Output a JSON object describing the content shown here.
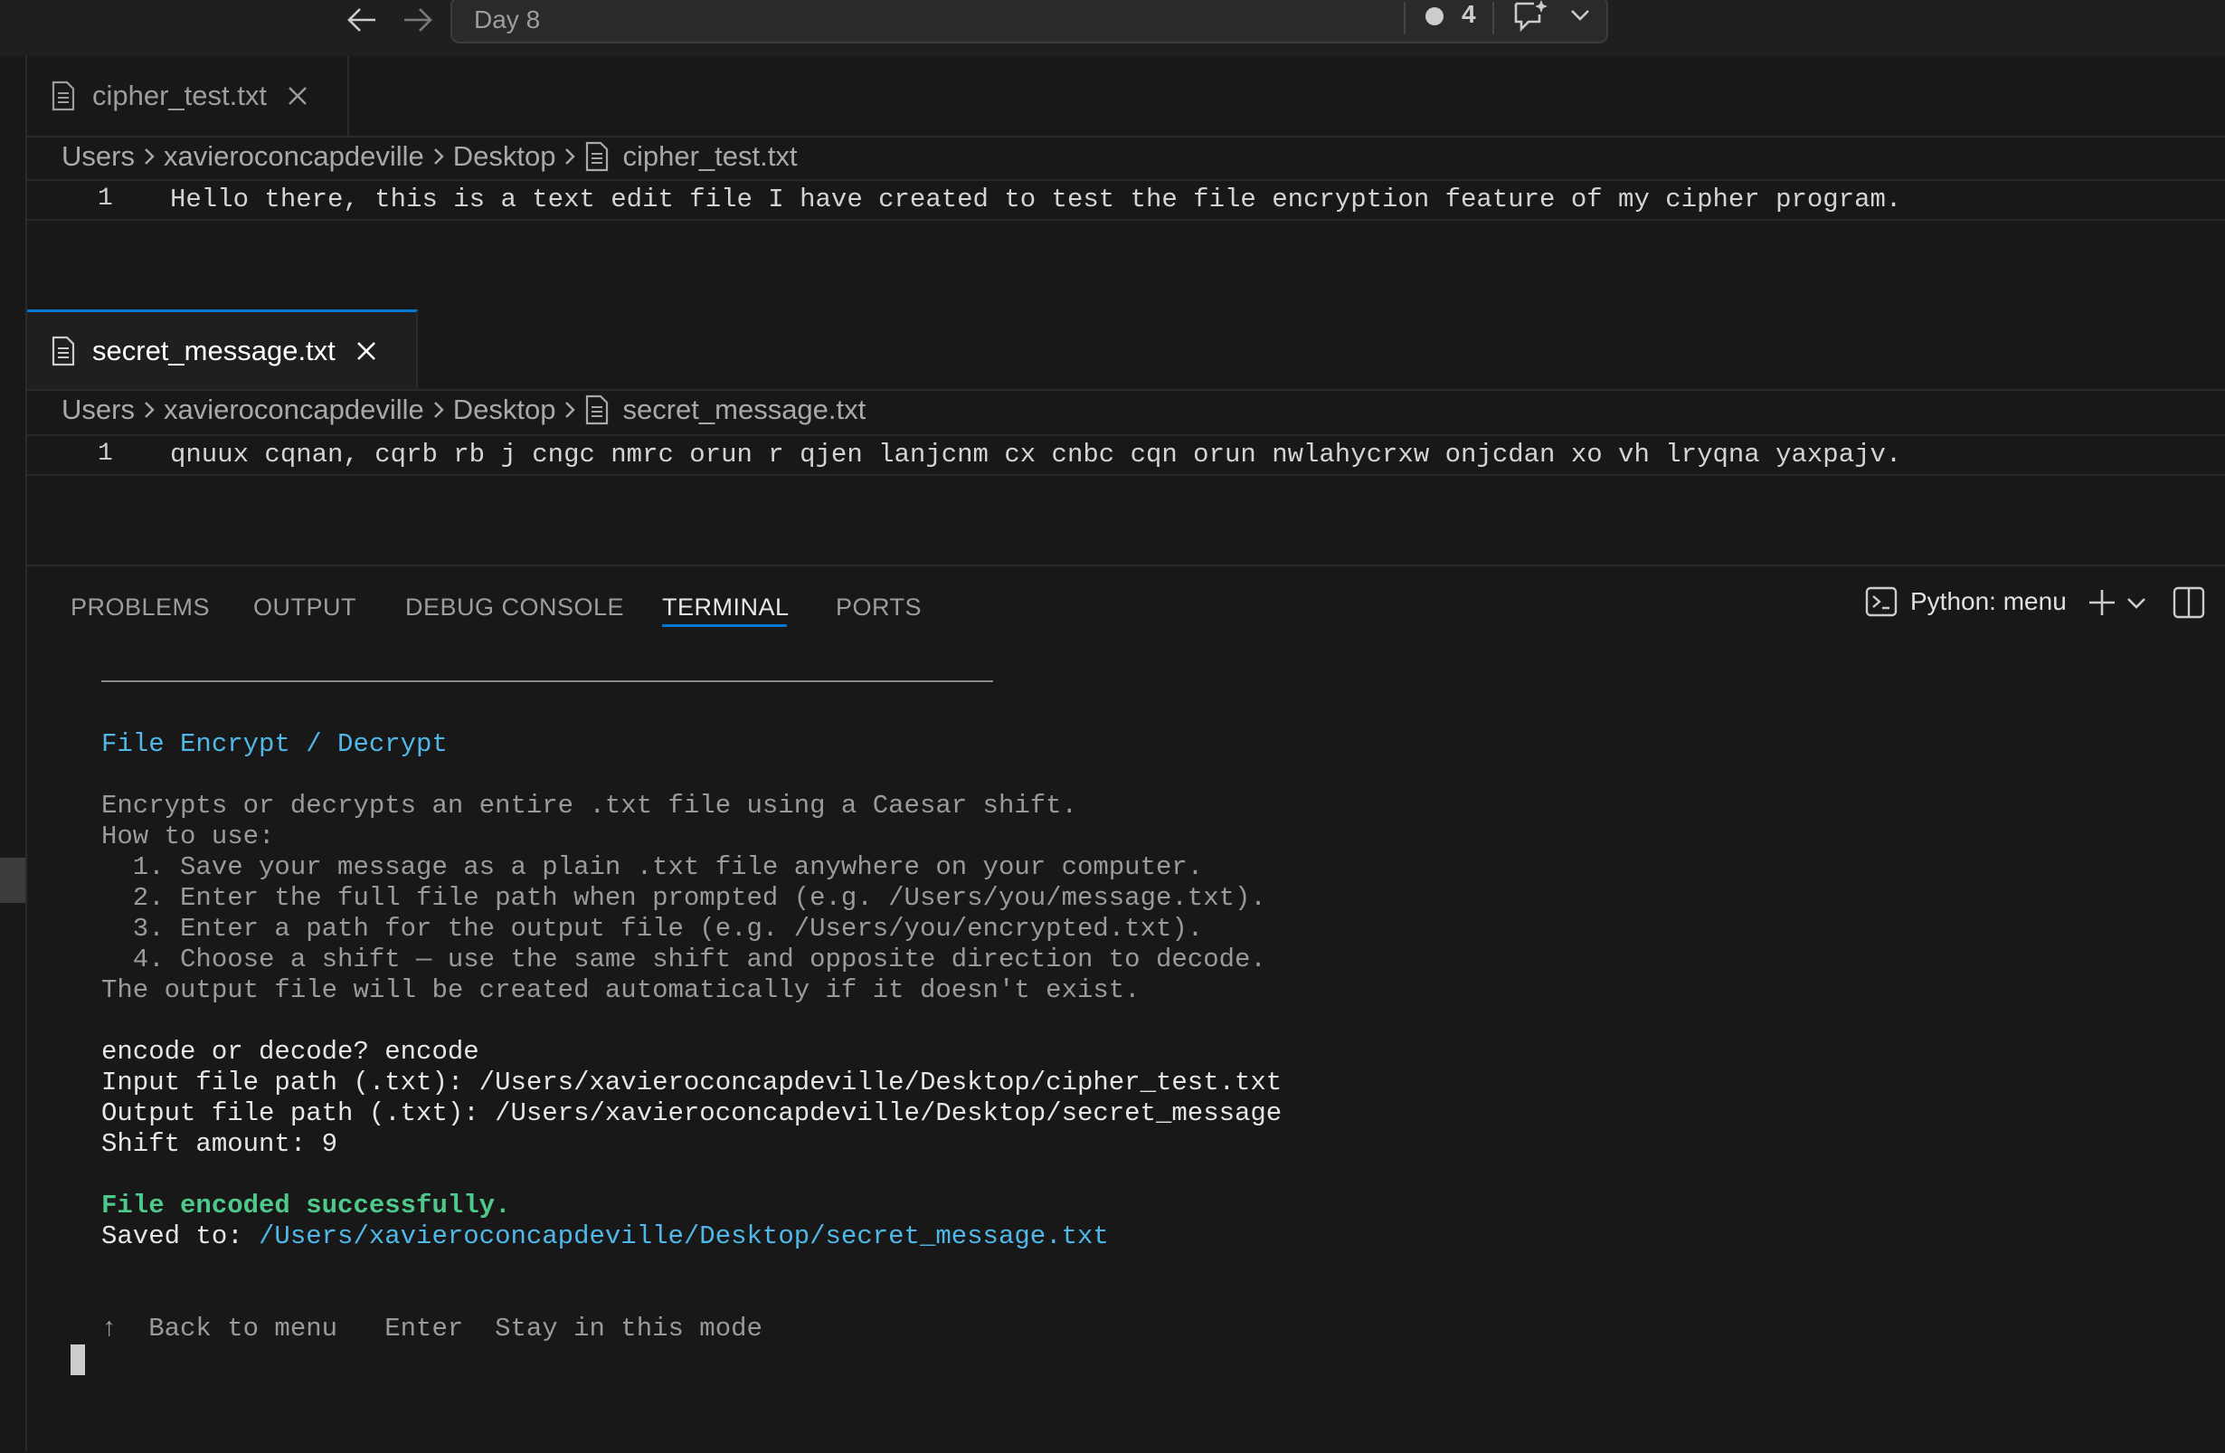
{
  "titlebar": {
    "back_label": "←",
    "forward_label": "→",
    "search_text": "Day 8",
    "notification_count": "4"
  },
  "editor_top": {
    "tab_label": "cipher_test.txt",
    "breadcrumb": [
      "Users",
      "xavieroconcapdeville",
      "Desktop",
      "cipher_test.txt"
    ],
    "line_number": "1",
    "line_text": "Hello there, this is a text edit file I have created to test the file encryption feature of my cipher program."
  },
  "editor_bottom": {
    "tab_label": "secret_message.txt",
    "breadcrumb": [
      "Users",
      "xavieroconcapdeville",
      "Desktop",
      "secret_message.txt"
    ],
    "line_number": "1",
    "line_text": "qnuux cqnan, cqrb rb j cngc nmrc orun r qjen lanjcnm cx cnbc cqn orun nwlahycrxw onjcdan xo vh lryqna yaxpajv."
  },
  "panel": {
    "tabs": [
      "PROBLEMS",
      "OUTPUT",
      "DEBUG CONSOLE",
      "TERMINAL",
      "PORTS"
    ],
    "active_tab": "TERMINAL",
    "terminal_name": "Python: menu"
  },
  "terminal": {
    "heading": "File Encrypt / Decrypt",
    "description": [
      "Encrypts or decrypts an entire .txt file using a Caesar shift.",
      "How to use:",
      "  1. Save your message as a plain .txt file anywhere on your computer.",
      "  2. Enter the full file path when prompted (e.g. /Users/you/message.txt).",
      "  3. Enter a path for the output file (e.g. /Users/you/encrypted.txt).",
      "  4. Choose a shift — use the same shift and opposite direction to decode.",
      "The output file will be created automatically if it doesn't exist."
    ],
    "prompts": [
      "encode or decode? encode",
      "Input file path (.txt): /Users/xavieroconcapdeville/Desktop/cipher_test.txt",
      "Output file path (.txt): /Users/xavieroconcapdeville/Desktop/secret_message",
      "Shift amount: 9"
    ],
    "success": "File encoded successfully.",
    "saved_label": "Saved to: ",
    "saved_path": "/Users/xavieroconcapdeville/Desktop/secret_message.txt",
    "footer": "↑  Back to menu   Enter  Stay in this mode"
  }
}
